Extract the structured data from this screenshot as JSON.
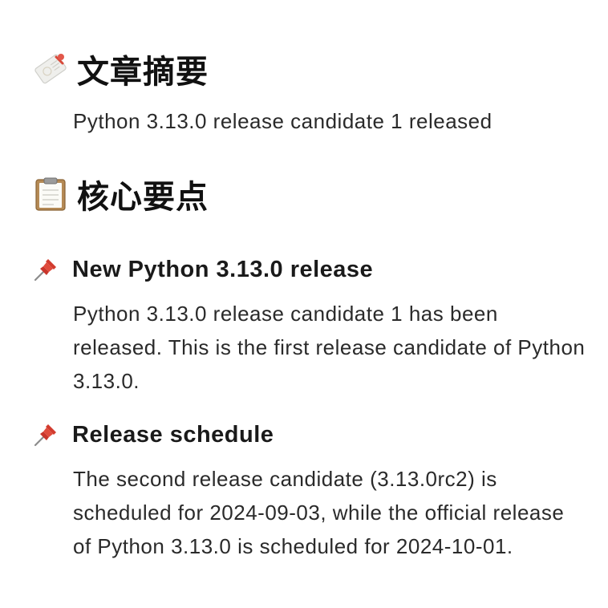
{
  "summary": {
    "icon": "memo-pen-icon",
    "title": "文章摘要",
    "text": "Python 3.13.0 release candidate 1 released"
  },
  "key_points": {
    "icon": "clipboard-icon",
    "title": "核心要点",
    "items": [
      {
        "icon": "pushpin-icon",
        "title": "New Python 3.13.0 release",
        "body": "Python 3.13.0 release candidate 1 has been released. This is the first release candidate of Python 3.13.0."
      },
      {
        "icon": "pushpin-icon",
        "title": "Release schedule",
        "body": "The second release candidate (3.13.0rc2) is scheduled for 2024-09-03, while the official release of Python 3.13.0 is scheduled for 2024-10-01."
      }
    ]
  }
}
